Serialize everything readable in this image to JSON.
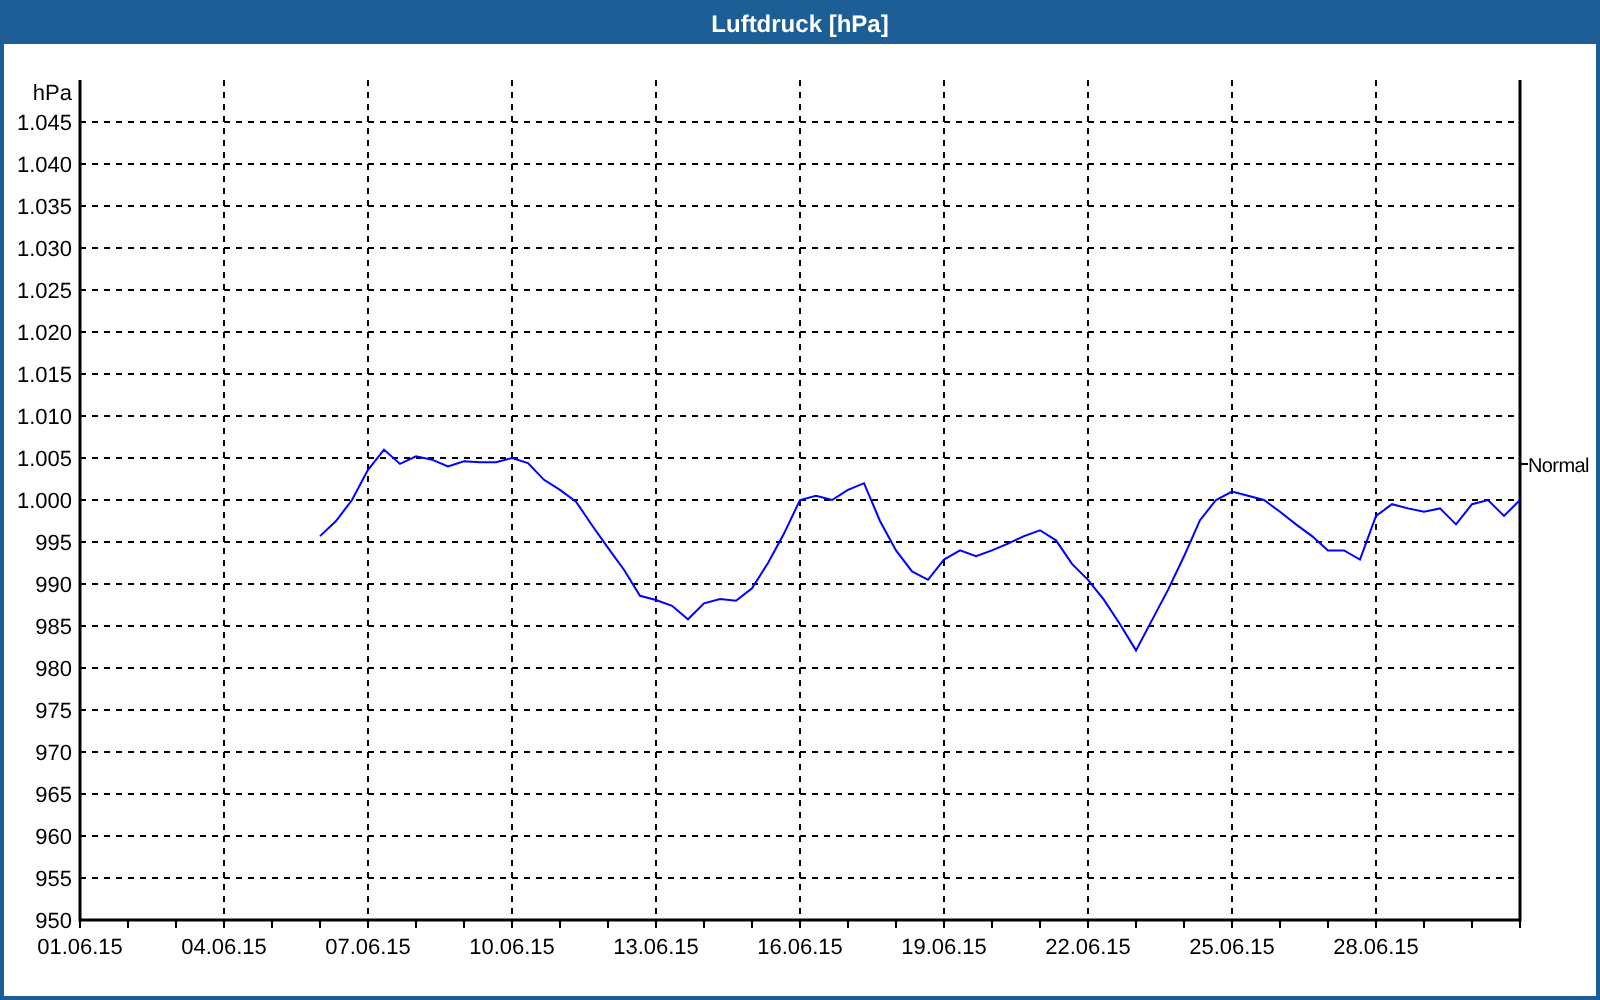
{
  "window": {
    "title": "Luftdruck [hPa]"
  },
  "chart": {
    "chart_data": {
      "type": "line",
      "grid": true,
      "ylabel": "hPa",
      "ylim": [
        950,
        1050
      ],
      "categories": [
        "01.06.15",
        null,
        null,
        null,
        null,
        null,
        null,
        null,
        null,
        "04.06.15",
        null,
        null,
        null,
        null,
        null,
        null,
        null,
        null,
        "07.06.15",
        null,
        null,
        null,
        null,
        null,
        null,
        null,
        null,
        "10.06.15",
        null,
        null,
        null,
        null,
        null,
        null,
        null,
        null,
        "13.06.15",
        null,
        null,
        null,
        null,
        null,
        null,
        null,
        null,
        "16.06.15",
        null,
        null,
        null,
        null,
        null,
        null,
        null,
        null,
        "19.06.15",
        null,
        null,
        null,
        null,
        null,
        null,
        null,
        null,
        "22.06.15",
        null,
        null,
        null,
        null,
        null,
        null,
        null,
        null,
        "25.06.15",
        null,
        null,
        null,
        null,
        null,
        null,
        null,
        null,
        "28.06.15",
        null,
        null,
        null,
        null,
        null,
        null,
        null,
        null,
        null
      ],
      "yticks": [
        950,
        955,
        960,
        965,
        970,
        975,
        980,
        985,
        990,
        995,
        {
          "value": 1000,
          "label": "1.000"
        },
        {
          "value": 1005,
          "label": "1.005"
        },
        {
          "value": 1010,
          "label": "1.010"
        },
        {
          "value": 1015,
          "label": "1.015"
        },
        {
          "value": 1020,
          "label": "1.020"
        },
        {
          "value": 1025,
          "label": "1.025"
        },
        {
          "value": 1030,
          "label": "1.030"
        },
        {
          "value": 1035,
          "label": "1.035"
        },
        {
          "value": 1040,
          "label": "1.040"
        },
        {
          "value": 1045,
          "label": "1.045"
        }
      ],
      "series": [
        {
          "color": "#0000ff",
          "values": [
            null,
            null,
            null,
            null,
            null,
            null,
            null,
            null,
            null,
            null,
            null,
            null,
            null,
            null,
            null,
            995.7,
            997.5,
            1000,
            1003.6,
            1006,
            1004.3,
            1005.2,
            1004.8,
            1004,
            1004.6,
            1004.5,
            1004.5,
            1005,
            1004.4,
            1002.4,
            1001.2,
            999.8,
            997,
            994.3,
            991.7,
            988.6,
            988.1,
            987.4,
            985.8,
            987.7,
            988.2,
            988,
            989.5,
            992.5,
            996,
            1000,
            1000.5,
            1000,
            1001.2,
            1002,
            997.5,
            994,
            991.5,
            990.5,
            992.9,
            994,
            993.3,
            994,
            994.8,
            995.7,
            996.4,
            995.2,
            992.4,
            990.5,
            988.1,
            985.2,
            982.1,
            985.7,
            989.3,
            993.3,
            997.6,
            1000,
            1001,
            1000.5,
            1000,
            998.6,
            997.1,
            995.7,
            994,
            994,
            992.9,
            998.1,
            999.5,
            999,
            998.6,
            999,
            997.1,
            999.5,
            1000,
            998.1,
            1000
          ]
        }
      ],
      "annotations": [
        "Normal"
      ]
    }
  }
}
